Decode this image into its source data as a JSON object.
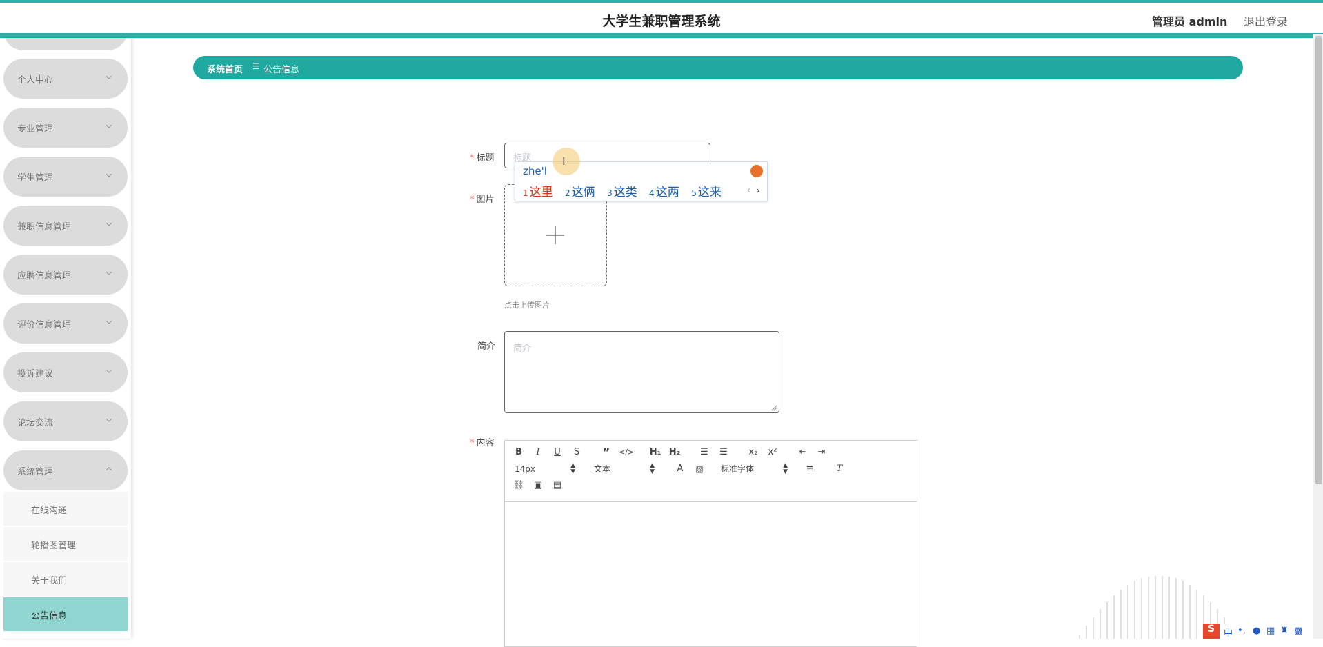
{
  "header": {
    "app_title": "大学生兼职管理系统",
    "admin_label": "管理员 admin",
    "logout_label": "退出登录"
  },
  "sidebar": {
    "items": [
      {
        "label": "个人中心"
      },
      {
        "label": "专业管理"
      },
      {
        "label": "学生管理"
      },
      {
        "label": "兼职信息管理"
      },
      {
        "label": "应聘信息管理"
      },
      {
        "label": "评价信息管理"
      },
      {
        "label": "投诉建议"
      },
      {
        "label": "论坛交流"
      },
      {
        "label": "系统管理"
      }
    ],
    "subitems": [
      {
        "label": "在线沟通"
      },
      {
        "label": "轮播图管理"
      },
      {
        "label": "关于我们"
      },
      {
        "label": "公告信息",
        "active": true
      }
    ]
  },
  "breadcrumb": {
    "home": "系统首页",
    "separator": "☰",
    "current": "公告信息"
  },
  "form": {
    "title_label": "标题",
    "title_placeholder": "标题",
    "image_label": "图片",
    "upload_tip": "点击上传图片",
    "intro_label": "简介",
    "intro_placeholder": "简介",
    "content_label": "内容",
    "required_mark": "*"
  },
  "editor": {
    "font_size": "14px",
    "paragraph": "文本",
    "font_family": "标准字体"
  },
  "ime": {
    "input": "zhe'l",
    "candidates": [
      {
        "num": "1",
        "text": "这里"
      },
      {
        "num": "2",
        "text": "这俩"
      },
      {
        "num": "3",
        "text": "这类"
      },
      {
        "num": "4",
        "text": "这两"
      },
      {
        "num": "5",
        "text": "这来"
      }
    ],
    "prev": "‹",
    "next": "›"
  },
  "tray": {
    "ime_mode": "中",
    "punct": "•,"
  },
  "colors": {
    "accent": "#1fa9a1",
    "sidebar_item_bg": "#dcdcdc",
    "active_sub_bg": "#8fd6d1",
    "required": "#f56c6c"
  }
}
